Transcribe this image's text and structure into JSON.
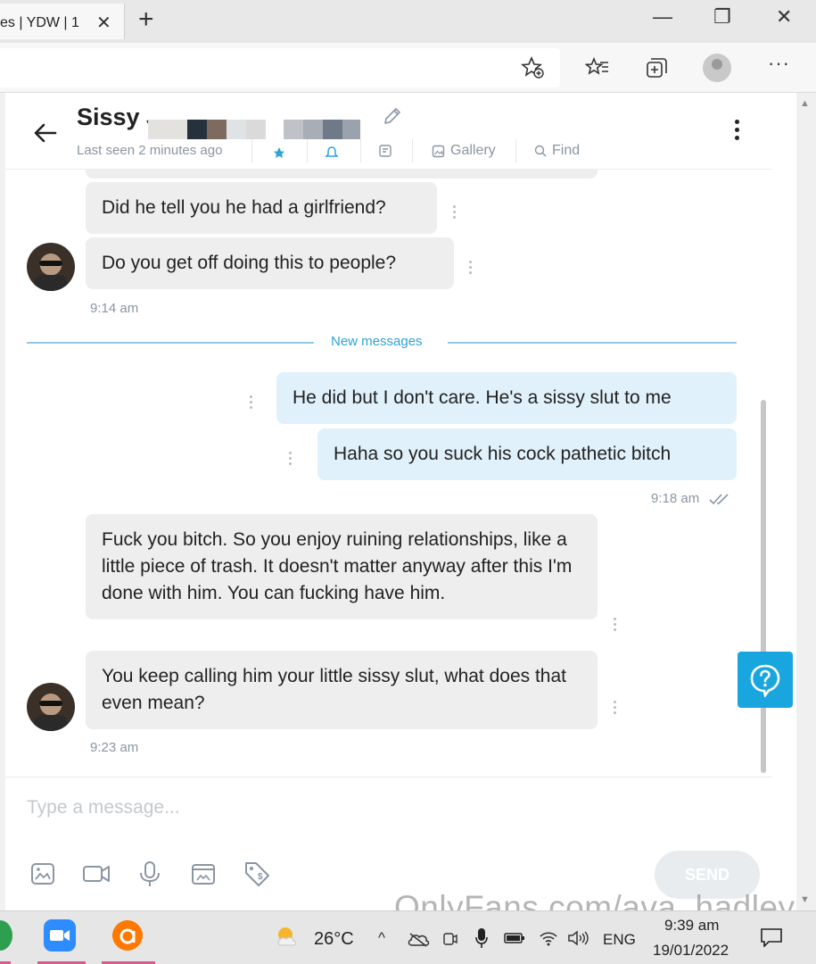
{
  "browser": {
    "tab_title": "es | YDW | 1",
    "tab_close": "✕",
    "new_tab": "+",
    "win_min": "—",
    "win_max": "❐",
    "win_close": "✕",
    "more": "···"
  },
  "chat": {
    "contact_name": "Sissy J",
    "last_seen": "Last seen 2 minutes ago",
    "actions": [
      "Gallery",
      "Find"
    ],
    "divider_label": "New messages",
    "messages": [
      {
        "text": "Did he tell you he had a girlfriend?",
        "side": "in"
      },
      {
        "text": "Do you get off doing this to people?",
        "side": "in"
      },
      {
        "text": "He did but I don't care. He's a sissy slut to me",
        "side": "out"
      },
      {
        "text": "Haha so you suck his cock pathetic bitch",
        "side": "out"
      },
      {
        "text": "Fuck you bitch. So you enjoy ruining relationships, like a little piece of trash. It doesn't matter anyway after this I'm done with him. You can fucking have him.",
        "side": "in"
      },
      {
        "text": "You keep calling him your little sissy slut, what does that even mean?",
        "side": "in"
      }
    ],
    "timestamps": [
      "9:14 am",
      "9:18 am",
      "9:23 am"
    ],
    "placeholder": "Type a message...",
    "send_label": "SEND"
  },
  "taskbar": {
    "temperature": "26°C",
    "language": "ENG",
    "time": "9:39 am",
    "date": "19/01/2022"
  },
  "watermark": "OnlyFans.com/ava_hadley",
  "colors": {
    "accent": "#19a6df",
    "incoming_bubble": "#eeeeee",
    "outgoing_bubble": "#e0f1fb",
    "divider": "#8fc9e6"
  }
}
